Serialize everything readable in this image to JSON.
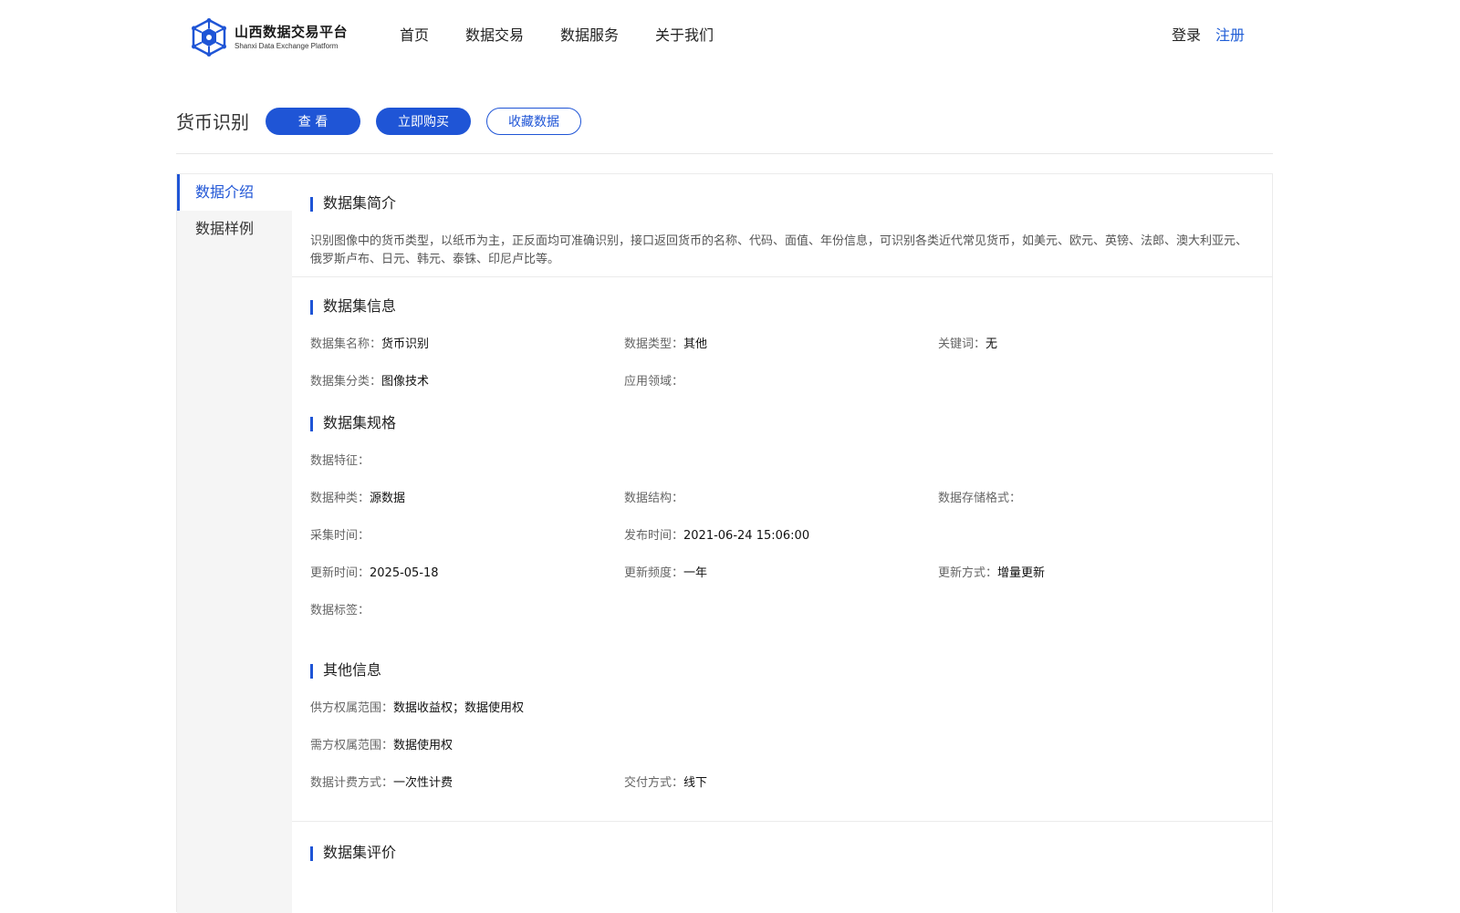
{
  "header": {
    "logo_title": "山西数据交易平台",
    "logo_subtitle": "Shanxi Data Exchange Platform",
    "nav": [
      "首页",
      "数据交易",
      "数据服务",
      "关于我们"
    ],
    "login": "登录",
    "register": "注册"
  },
  "titlebar": {
    "title": "货币识别",
    "view_label": "查 看",
    "buy_label": "立即购买",
    "favorite_label": "收藏数据"
  },
  "sidebar": {
    "items": [
      "数据介绍",
      "数据样例"
    ]
  },
  "intro": {
    "title": "数据集简介",
    "text": "识别图像中的货币类型，以纸币为主，正反面均可准确识别，接口返回货币的名称、代码、面值、年份信息，可识别各类近代常见货币，如美元、欧元、英镑、法郎、澳大利亚元、俄罗斯卢布、日元、韩元、泰铢、印尼卢比等。"
  },
  "info": {
    "title": "数据集信息",
    "name_label": "数据集名称：",
    "name_value": "货币识别",
    "type_label": "数据类型：",
    "type_value": "其他",
    "keyword_label": "关键词：",
    "keyword_value": "无",
    "category_label": "数据集分类：",
    "category_value": "图像技术",
    "domain_label": "应用领域：",
    "domain_value": ""
  },
  "spec": {
    "title": "数据集规格",
    "feature_label": "数据特征：",
    "feature_value": "",
    "kind_label": "数据种类：",
    "kind_value": "源数据",
    "structure_label": "数据结构：",
    "structure_value": "",
    "storage_label": "数据存储格式：",
    "storage_value": "",
    "collect_label": "采集时间：",
    "collect_value": "",
    "publish_label": "发布时间：",
    "publish_value": "2021-06-24 15:06:00",
    "update_label": "更新时间：",
    "update_value": "2025-05-18",
    "freq_label": "更新频度：",
    "freq_value": "一年",
    "mode_label": "更新方式：",
    "mode_value": "增量更新",
    "tag_label": "数据标签：",
    "tag_value": ""
  },
  "other": {
    "title": "其他信息",
    "supply_label": "供方权属范围：",
    "supply_value": "数据收益权；数据使用权",
    "demand_label": "需方权属范围：",
    "demand_value": "数据使用权",
    "billing_label": "数据计费方式：",
    "billing_value": "一次性计费",
    "delivery_label": "交付方式：",
    "delivery_value": "线下"
  },
  "review": {
    "title": "数据集评价"
  },
  "colors": {
    "accent": "#1f55d6",
    "sidebar_bg": "#f5f5f5",
    "border": "#ebebeb"
  },
  "icons": {
    "logo": "hexagon-network-icon"
  }
}
